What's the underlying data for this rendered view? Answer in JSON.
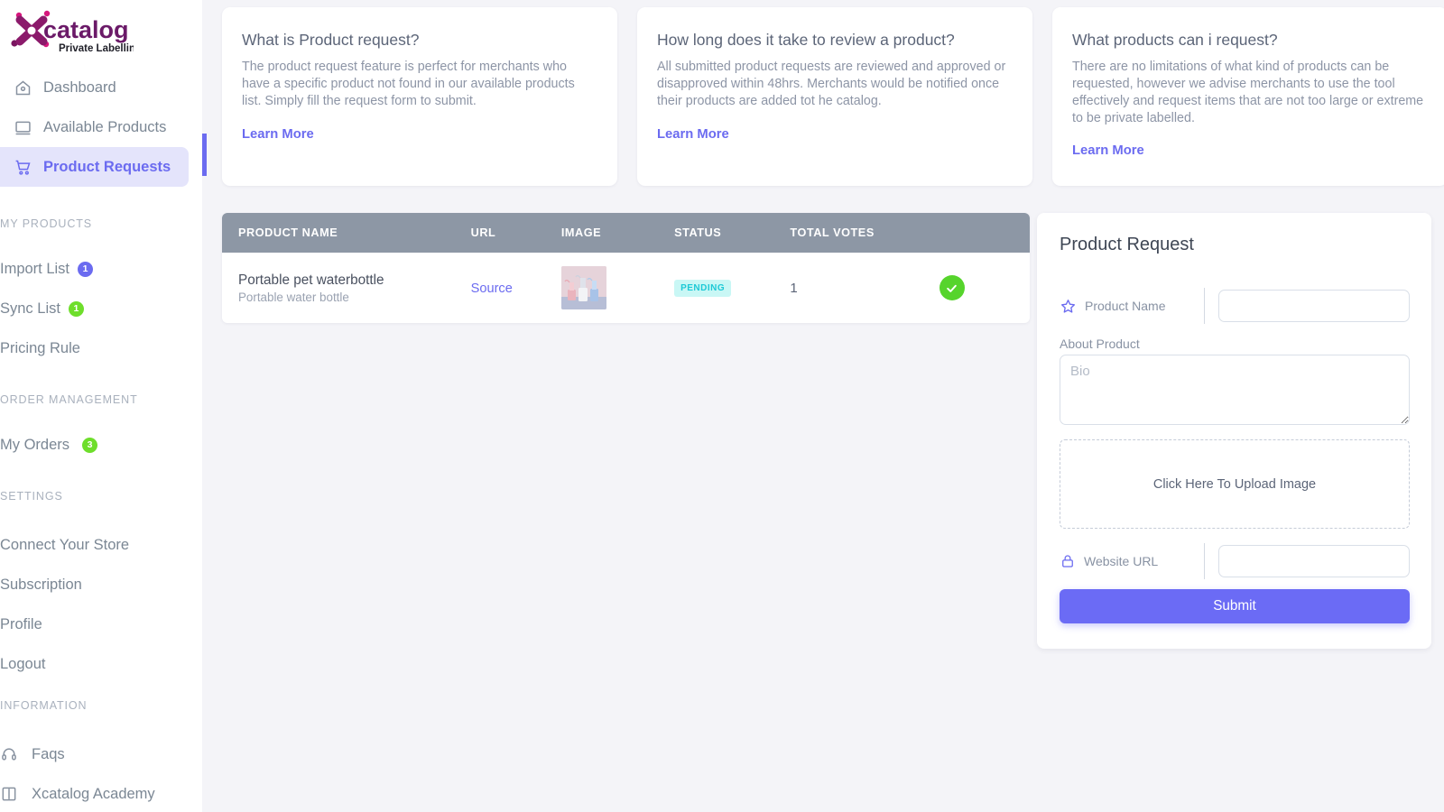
{
  "brand": {
    "name": "catalog",
    "tagline": "Private Labelling",
    "logo_icon": "x-logo-icon",
    "accent": "#6b6bf0",
    "logo_purple": "#8b1a6b",
    "logo_magenta": "#d6177d"
  },
  "sidebar": {
    "top_items": [
      {
        "label": "Dashboard",
        "icon": "home-icon",
        "active": false
      },
      {
        "label": "Available Products",
        "icon": "monitor-icon",
        "active": false
      },
      {
        "label": "Product Requests",
        "icon": "cart-icon",
        "active": true
      }
    ],
    "sections": [
      {
        "title": "MY PRODUCTS",
        "items": [
          {
            "label": "Import List",
            "badge": "1",
            "badge_color": "purple"
          },
          {
            "label": "Sync List",
            "badge": "1",
            "badge_color": "green"
          },
          {
            "label": "Pricing Rule",
            "badge": null,
            "badge_color": null
          }
        ]
      },
      {
        "title": "ORDER MANAGEMENT",
        "items": [
          {
            "label": "My Orders",
            "badge": "3",
            "badge_color": "green"
          }
        ]
      },
      {
        "title": "SETTINGS",
        "items": [
          {
            "label": "Connect Your Store",
            "badge": null,
            "badge_color": null
          },
          {
            "label": "Subscription",
            "badge": null,
            "badge_color": null
          },
          {
            "label": "Profile",
            "badge": null,
            "badge_color": null
          },
          {
            "label": "Logout",
            "badge": null,
            "badge_color": null
          }
        ]
      }
    ],
    "information": {
      "title": "INFORMATION",
      "items": [
        {
          "label": "Faqs",
          "icon": "headset-icon"
        },
        {
          "label": "Xcatalog Academy",
          "icon": "book-icon"
        }
      ]
    }
  },
  "info_cards": [
    {
      "heading": "What is Product request?",
      "body": "The product request feature is perfect for merchants who have a specific product not found in our available products list. Simply fill the request form to submit.",
      "link": "Learn More"
    },
    {
      "heading": "How long does it take to review a product?",
      "body": "All submitted product requests are reviewed and approved or disapproved within 48hrs. Merchants would be notified once their products are added tot he catalog.",
      "link": "Learn More"
    },
    {
      "heading": "What products can i request?",
      "body": "There are no limitations of what kind of products can be requested, however we advise merchants to use the tool effectively and request items that are not too large or extreme to be private labelled.",
      "link": "Learn More"
    }
  ],
  "table": {
    "columns": [
      "PRODUCT NAME",
      "URL",
      "IMAGE",
      "STATUS",
      "TOTAL VOTES",
      ""
    ],
    "rows": [
      {
        "product_name": "Portable pet waterbottle",
        "product_sub": "Portable water bottle",
        "url_label": "Source",
        "image_alt": "pet-waterbottle-thumbnail",
        "status": "PENDING",
        "status_color": "#1dc9d6",
        "total_votes": "1",
        "action_icon": "check-icon",
        "action_color": "#56d42c"
      }
    ]
  },
  "form": {
    "title": "Product Request",
    "product_name": {
      "label": "Product Name",
      "icon": "star-icon",
      "value": "",
      "placeholder": ""
    },
    "about": {
      "label": "About Product",
      "value": "",
      "placeholder": "Bio"
    },
    "upload": {
      "label": "Click Here To Upload Image",
      "icon": "upload-zone"
    },
    "website_url": {
      "label": "Website URL",
      "icon": "lock-icon",
      "value": "",
      "placeholder": ""
    },
    "submit_label": "Submit"
  }
}
